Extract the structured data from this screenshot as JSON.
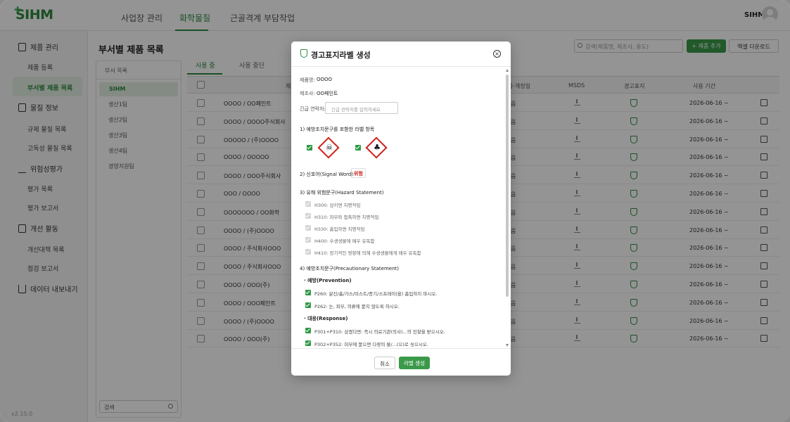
{
  "header": {
    "logo": "SIHM",
    "nav": [
      "사업장 관리",
      "화학물질",
      "근골격계 부담작업"
    ],
    "active_nav": 1,
    "user_name": "SIHM"
  },
  "sidebar": {
    "sections": [
      {
        "label": "제품 관리",
        "items": [
          "제품 등록",
          "부서별 제품 목록"
        ]
      },
      {
        "label": "물질 정보",
        "items": [
          "규제 물질 목록",
          "고독성 물질 목록"
        ]
      },
      {
        "label": "위험성평가",
        "items": [
          "평가 목록",
          "평가 보고서"
        ]
      },
      {
        "label": "개선 활동",
        "items": [
          "개선대책 목록",
          "점검 보고서"
        ]
      },
      {
        "label": "데이터 내보내기",
        "items": []
      }
    ],
    "active_item": "부서별 제품 목록",
    "version": "v2.15.0"
  },
  "main": {
    "title": "부서별 제품 목록",
    "search_placeholder": "검색(제품명, 제조사, 용도)",
    "add_button": "+ 제품 추가",
    "excel_button": "엑셀 다운로드",
    "dept_panel": {
      "header": "부서 목록",
      "root": "SIHM",
      "items": [
        "생산1팀",
        "생산2팀",
        "생산3팀",
        "생산4팀",
        "경영지원팀"
      ],
      "search_value": "검색"
    },
    "tabs": [
      "사용 중",
      "사용 중단"
    ],
    "active_tab": 0,
    "columns": [
      "제",
      "중·개정일",
      "MSDS",
      "경고표지",
      "사용 기간"
    ],
    "rows": [
      {
        "product": "OOOO / OO페인트",
        "rev": "음",
        "period": "2026-06-16 ~"
      },
      {
        "product": "OOOO / OOOO주식회사",
        "rev": "음",
        "period": "2026-06-16 ~"
      },
      {
        "product": "OOOOO / (주)OOOO",
        "rev": "음",
        "period": "2026-06-16 ~"
      },
      {
        "product": "OOOO / OOOOO",
        "rev": "음",
        "period": "2026-06-16 ~"
      },
      {
        "product": "OOOO / OOO주식회사",
        "rev": "음",
        "period": "2026-06-16 ~"
      },
      {
        "product": "OOO / OOOO",
        "rev": "음",
        "period": "2026-06-16 ~"
      },
      {
        "product": "OOOOOOO / OO화학",
        "rev": "음",
        "period": "2026-06-16 ~"
      },
      {
        "product": "OOOO / (주)OOOO",
        "rev": "음",
        "period": "2026-06-16 ~"
      },
      {
        "product": "OOOO / 주식회사OOO",
        "rev": "음",
        "period": "2026-06-16 ~"
      },
      {
        "product": "OOOO / 주식회사OOO",
        "rev": "음",
        "period": "2026-06-16 ~"
      },
      {
        "product": "OOOO / OOO(주)",
        "rev": "음",
        "period": "2026-06-16 ~"
      },
      {
        "product": "OOOO / OOO페인트",
        "rev": "음",
        "period": "2026-06-16 ~"
      },
      {
        "product": "OOOO / (주)OOOO",
        "rev": "음",
        "period": "2026-06-16 ~"
      },
      {
        "product": "OOOO / OOO(주)",
        "rev": "음",
        "period": "2026-06-16 ~"
      }
    ]
  },
  "modal": {
    "title": "경고표지라벨 생성",
    "product_label": "제품명:",
    "product_value": "OOOO",
    "maker_label": "제조사:",
    "maker_value": "OO페인트",
    "emergency_label": "긴급 연락처:",
    "emergency_placeholder": "긴급 연락처를 입력하세요",
    "section1": "1) 예방조치문구를 포함한 라벨 항목",
    "section2": "2) 신호어(Signal Word):",
    "signal_word": "위험",
    "section3": "3) 유해 위험문구(Hazard Statement)",
    "hazards": [
      "H300: 삼키면 치명적임",
      "H310: 피부와 접촉하면 치명적임",
      "H330: 흡입하면 치명적임",
      "H400: 수생생물에 매우 유독함",
      "H410: 장기적인 영향에 의해 수생생물에게 매우 유독함"
    ],
    "section4": "4) 예방조치문구(Precautionary Statement)",
    "prevention_title": "· 예방(Prevention)",
    "prevention": [
      "P260: 분진/흄/가스/미스트/증기/스프레이(을) 흡입하지 마시오.",
      "P262: 눈, 피부, 의류에 묻지 않도록 하시오."
    ],
    "response_title": "· 대응(Response)",
    "response": [
      "P301+P310: 삼켰다면: 즉시 의료기관(의사)...의 진찰을 받으시오.",
      "P302+P352: 피부에 묻으면 다량의 물/...(으)로 씻으시오."
    ],
    "cancel": "취소",
    "create": "라벨 생성"
  }
}
